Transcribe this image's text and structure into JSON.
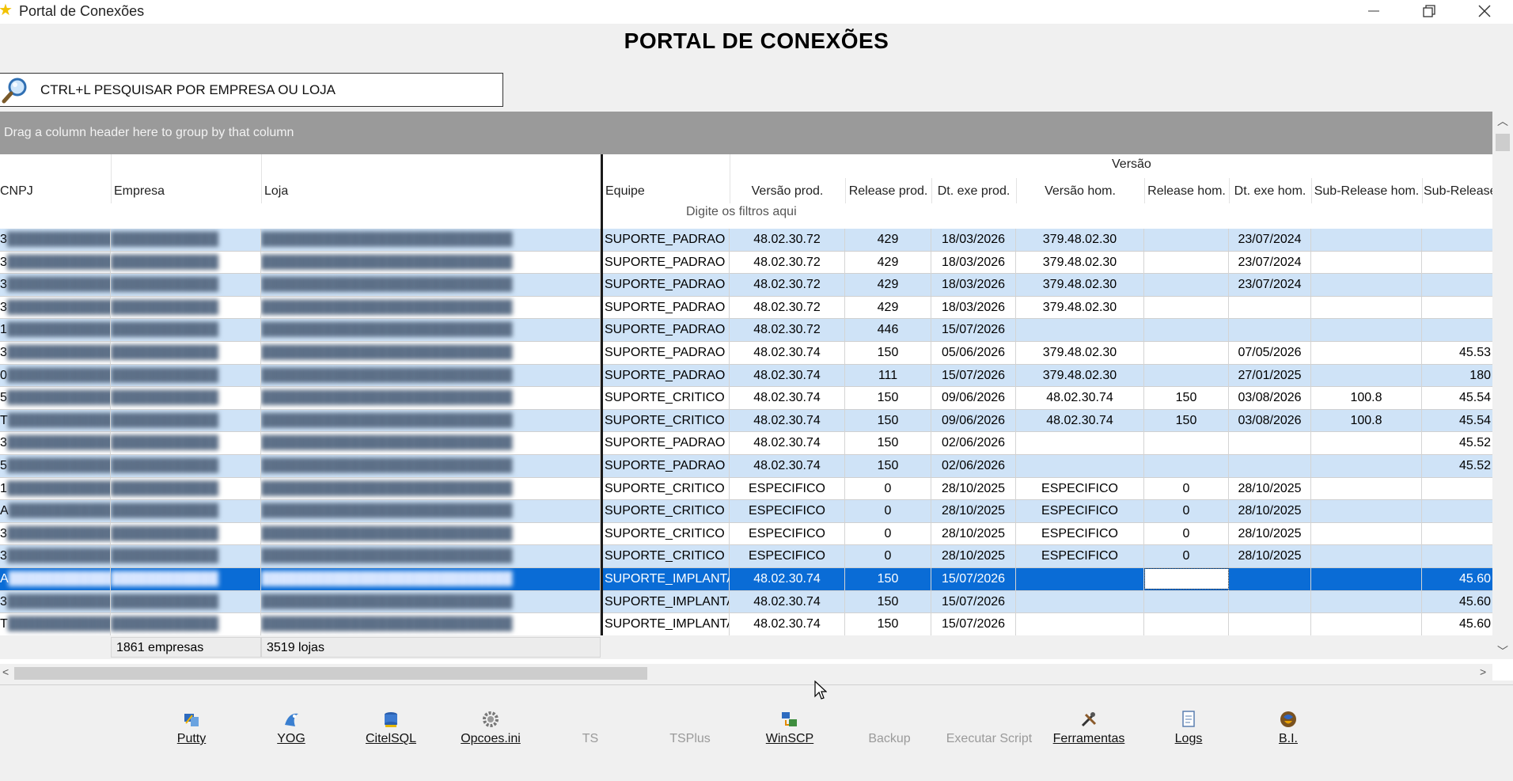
{
  "window": {
    "title": "Portal de Conexões"
  },
  "heading": "PORTAL DE CONEXÕES",
  "search": {
    "placeholder": "CTRL+L PESQUISAR POR EMPRESA OU LOJA"
  },
  "grid": {
    "group_panel_text": "Drag a column header here to group by that column",
    "band_label": "Versão",
    "filter_hint": "Digite os filtros aqui",
    "columns": {
      "cnpj": "CNPJ",
      "empresa": "Empresa",
      "loja": "Loja",
      "equipe": "Equipe",
      "versao_prod": "Versão prod.",
      "release_prod": "Release prod.",
      "dt_exe_prod": "Dt. exe prod.",
      "versao_hom": "Versão hom.",
      "release_hom": "Release hom.",
      "dt_exe_hom": "Dt. exe hom.",
      "sub_release_hom": "Sub-Release hom.",
      "sub_release": "Sub-Release"
    },
    "rows": [
      {
        "cnpj": "3",
        "empresa": "",
        "loja": "",
        "equipe": "SUPORTE_PADRAO",
        "versao_prod": "48.02.30.72",
        "release_prod": "429",
        "dt_exe_prod": "18/03/2026",
        "versao_hom": "379.48.02.30",
        "release_hom": "",
        "dt_exe_hom": "23/07/2024",
        "sub_release_hom": "",
        "sub_release": ""
      },
      {
        "cnpj": "3",
        "empresa": "",
        "loja": "",
        "equipe": "SUPORTE_PADRAO",
        "versao_prod": "48.02.30.72",
        "release_prod": "429",
        "dt_exe_prod": "18/03/2026",
        "versao_hom": "379.48.02.30",
        "release_hom": "",
        "dt_exe_hom": "23/07/2024",
        "sub_release_hom": "",
        "sub_release": ""
      },
      {
        "cnpj": "3",
        "empresa": "",
        "loja": "",
        "equipe": "SUPORTE_PADRAO",
        "versao_prod": "48.02.30.72",
        "release_prod": "429",
        "dt_exe_prod": "18/03/2026",
        "versao_hom": "379.48.02.30",
        "release_hom": "",
        "dt_exe_hom": "23/07/2024",
        "sub_release_hom": "",
        "sub_release": ""
      },
      {
        "cnpj": "3",
        "empresa": "",
        "loja": "",
        "equipe": "SUPORTE_PADRAO",
        "versao_prod": "48.02.30.72",
        "release_prod": "429",
        "dt_exe_prod": "18/03/2026",
        "versao_hom": "379.48.02.30",
        "release_hom": "",
        "dt_exe_hom": "",
        "sub_release_hom": "",
        "sub_release": ""
      },
      {
        "cnpj": "1",
        "empresa": "",
        "loja": "",
        "equipe": "SUPORTE_PADRAO",
        "versao_prod": "48.02.30.72",
        "release_prod": "446",
        "dt_exe_prod": "15/07/2026",
        "versao_hom": "",
        "release_hom": "",
        "dt_exe_hom": "",
        "sub_release_hom": "",
        "sub_release": ""
      },
      {
        "cnpj": "3",
        "empresa": "",
        "loja": "",
        "equipe": "SUPORTE_PADRAO",
        "versao_prod": "48.02.30.74",
        "release_prod": "150",
        "dt_exe_prod": "05/06/2026",
        "versao_hom": "379.48.02.30",
        "release_hom": "",
        "dt_exe_hom": "07/05/2026",
        "sub_release_hom": "",
        "sub_release": "45.53"
      },
      {
        "cnpj": "0",
        "empresa": "",
        "loja": "",
        "equipe": "SUPORTE_PADRAO",
        "versao_prod": "48.02.30.74",
        "release_prod": "111",
        "dt_exe_prod": "15/07/2026",
        "versao_hom": "379.48.02.30",
        "release_hom": "",
        "dt_exe_hom": "27/01/2025",
        "sub_release_hom": "",
        "sub_release": "180"
      },
      {
        "cnpj": "5",
        "empresa": "",
        "loja": "",
        "equipe": "SUPORTE_CRITICO",
        "versao_prod": "48.02.30.74",
        "release_prod": "150",
        "dt_exe_prod": "09/06/2026",
        "versao_hom": "48.02.30.74",
        "release_hom": "150",
        "dt_exe_hom": "03/08/2026",
        "sub_release_hom": "100.8",
        "sub_release": "45.54"
      },
      {
        "cnpj": "T",
        "empresa": "",
        "loja": "",
        "equipe": "SUPORTE_CRITICO",
        "versao_prod": "48.02.30.74",
        "release_prod": "150",
        "dt_exe_prod": "09/06/2026",
        "versao_hom": "48.02.30.74",
        "release_hom": "150",
        "dt_exe_hom": "03/08/2026",
        "sub_release_hom": "100.8",
        "sub_release": "45.54"
      },
      {
        "cnpj": "3",
        "empresa": "",
        "loja": "",
        "equipe": "SUPORTE_PADRAO",
        "versao_prod": "48.02.30.74",
        "release_prod": "150",
        "dt_exe_prod": "02/06/2026",
        "versao_hom": "",
        "release_hom": "",
        "dt_exe_hom": "",
        "sub_release_hom": "",
        "sub_release": "45.52"
      },
      {
        "cnpj": "5",
        "empresa": "",
        "loja": "",
        "equipe": "SUPORTE_PADRAO",
        "versao_prod": "48.02.30.74",
        "release_prod": "150",
        "dt_exe_prod": "02/06/2026",
        "versao_hom": "",
        "release_hom": "",
        "dt_exe_hom": "",
        "sub_release_hom": "",
        "sub_release": "45.52"
      },
      {
        "cnpj": "1",
        "empresa": "",
        "loja": "",
        "equipe": "SUPORTE_CRITICO",
        "versao_prod": "ESPECIFICO",
        "release_prod": "0",
        "dt_exe_prod": "28/10/2025",
        "versao_hom": "ESPECIFICO",
        "release_hom": "0",
        "dt_exe_hom": "28/10/2025",
        "sub_release_hom": "",
        "sub_release": ""
      },
      {
        "cnpj": "A",
        "empresa": "",
        "loja": "",
        "equipe": "SUPORTE_CRITICO",
        "versao_prod": "ESPECIFICO",
        "release_prod": "0",
        "dt_exe_prod": "28/10/2025",
        "versao_hom": "ESPECIFICO",
        "release_hom": "0",
        "dt_exe_hom": "28/10/2025",
        "sub_release_hom": "",
        "sub_release": ""
      },
      {
        "cnpj": "3",
        "empresa": "",
        "loja": "",
        "equipe": "SUPORTE_CRITICO",
        "versao_prod": "ESPECIFICO",
        "release_prod": "0",
        "dt_exe_prod": "28/10/2025",
        "versao_hom": "ESPECIFICO",
        "release_hom": "0",
        "dt_exe_hom": "28/10/2025",
        "sub_release_hom": "",
        "sub_release": ""
      },
      {
        "cnpj": "3",
        "empresa": "",
        "loja": "",
        "equipe": "SUPORTE_CRITICO",
        "versao_prod": "ESPECIFICO",
        "release_prod": "0",
        "dt_exe_prod": "28/10/2025",
        "versao_hom": "ESPECIFICO",
        "release_hom": "0",
        "dt_exe_hom": "28/10/2025",
        "sub_release_hom": "",
        "sub_release": ""
      },
      {
        "cnpj": "A",
        "empresa": "",
        "loja": "",
        "equipe": "SUPORTE_IMPLANTA",
        "versao_prod": "48.02.30.74",
        "release_prod": "150",
        "dt_exe_prod": "15/07/2026",
        "versao_hom": "",
        "release_hom": "",
        "dt_exe_hom": "",
        "sub_release_hom": "",
        "sub_release": "45.60",
        "selected": true
      },
      {
        "cnpj": "3",
        "empresa": "",
        "loja": "",
        "equipe": "SUPORTE_IMPLANTA",
        "versao_prod": "48.02.30.74",
        "release_prod": "150",
        "dt_exe_prod": "15/07/2026",
        "versao_hom": "",
        "release_hom": "",
        "dt_exe_hom": "",
        "sub_release_hom": "",
        "sub_release": "45.60"
      },
      {
        "cnpj": "T",
        "empresa": "",
        "loja": "",
        "equipe": "SUPORTE_IMPLANTA",
        "versao_prod": "48.02.30.74",
        "release_prod": "150",
        "dt_exe_prod": "15/07/2026",
        "versao_hom": "",
        "release_hom": "",
        "dt_exe_hom": "",
        "sub_release_hom": "",
        "sub_release": "45.60"
      }
    ],
    "footer": {
      "empresas": "1861 empresas",
      "lojas": "3519 lojas"
    }
  },
  "toolbar": [
    {
      "label": "Putty",
      "icon": "putty-icon",
      "enabled": true
    },
    {
      "label": "YOG",
      "icon": "yog-icon",
      "enabled": true
    },
    {
      "label": "CitelSQL",
      "icon": "database-icon",
      "enabled": true
    },
    {
      "label": "Opcoes.ini",
      "icon": "gear-icon",
      "enabled": true
    },
    {
      "label": "TS",
      "icon": "ts-icon",
      "enabled": false
    },
    {
      "label": "TSPlus",
      "icon": "tsplus-icon",
      "enabled": false
    },
    {
      "label": "WinSCP",
      "icon": "winscp-icon",
      "enabled": true
    },
    {
      "label": "Backup",
      "icon": "backup-icon",
      "enabled": false
    },
    {
      "label": "Executar Script",
      "icon": "script-icon",
      "enabled": false
    },
    {
      "label": "Ferramentas",
      "icon": "tools-icon",
      "enabled": true
    },
    {
      "label": "Logs",
      "icon": "logs-icon",
      "enabled": true
    },
    {
      "label": "B.I.",
      "icon": "bi-icon",
      "enabled": true
    }
  ],
  "colors": {
    "row_alt": "#cfe3f7",
    "selected": "#0a6cd6",
    "group_panel": "#9a9a9a"
  }
}
